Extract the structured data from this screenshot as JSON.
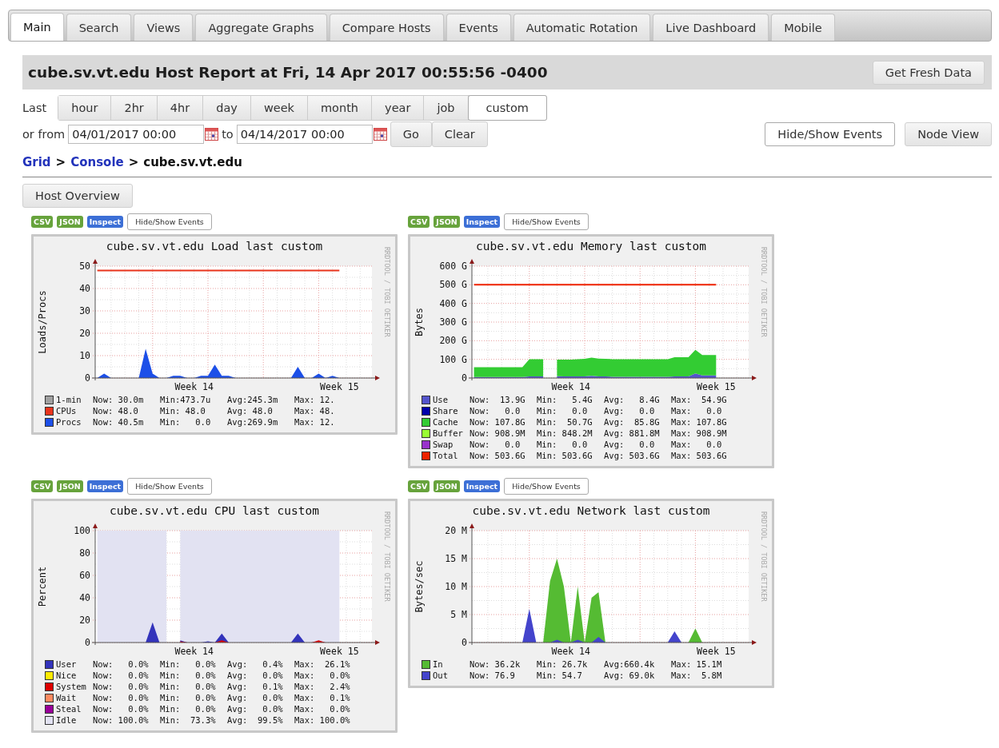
{
  "tabs": [
    {
      "label": "Main",
      "selected": true
    },
    {
      "label": "Search",
      "selected": false
    },
    {
      "label": "Views",
      "selected": false
    },
    {
      "label": "Aggregate Graphs",
      "selected": false
    },
    {
      "label": "Compare Hosts",
      "selected": false
    },
    {
      "label": "Events",
      "selected": false
    },
    {
      "label": "Automatic Rotation",
      "selected": false
    },
    {
      "label": "Live Dashboard",
      "selected": false
    },
    {
      "label": "Mobile",
      "selected": false
    }
  ],
  "report": {
    "title": "cube.sv.vt.edu Host Report at Fri, 14 Apr 2017 00:55:56 -0400",
    "refresh_button": "Get Fresh Data"
  },
  "range": {
    "label": "Last",
    "options": [
      {
        "label": "hour",
        "selected": false
      },
      {
        "label": "2hr",
        "selected": false
      },
      {
        "label": "4hr",
        "selected": false
      },
      {
        "label": "day",
        "selected": false
      },
      {
        "label": "week",
        "selected": false
      },
      {
        "label": "month",
        "selected": false
      },
      {
        "label": "year",
        "selected": false
      },
      {
        "label": "job",
        "selected": false
      },
      {
        "label": "custom",
        "selected": true
      }
    ]
  },
  "custom_range": {
    "label": "or from",
    "from": "04/01/2017 00:00",
    "to_label": "to",
    "to": "04/14/2017 00:00",
    "buttons": [
      "Go",
      "Clear"
    ]
  },
  "right_buttons": [
    {
      "label": "Hide/Show Events",
      "kind": "outline"
    },
    {
      "label": "Node View",
      "kind": "plain"
    }
  ],
  "breadcrumb": [
    {
      "label": "Grid",
      "kind": "link"
    },
    {
      "label": ">",
      "kind": "separator"
    },
    {
      "label": "Console",
      "kind": "link"
    },
    {
      "label": ">",
      "kind": "separator"
    },
    {
      "label": "cube.sv.vt.edu",
      "kind": "current"
    }
  ],
  "overview_button": "Host Overview",
  "graphs": [
    {
      "badges": [
        {
          "label": "CSV",
          "kind": "export"
        },
        {
          "label": "JSON",
          "kind": "export"
        },
        {
          "label": "Inspect",
          "kind": "inspect"
        }
      ],
      "events_button": "Hide/Show Events",
      "side_label": "RRDTOOL / TOBI OETIKER",
      "chart_data": {
        "type": "area",
        "title": "cube.sv.vt.edu Load last custom",
        "ylabel": "Loads/Procs",
        "categories": [
          null,
          null,
          null,
          null,
          null,
          null,
          null,
          null,
          null,
          null,
          null,
          null,
          null,
          null,
          "Week 14",
          null,
          null,
          null,
          null,
          null,
          null,
          null,
          null,
          null,
          null,
          null,
          null,
          null,
          null,
          null,
          null,
          null,
          null,
          null,
          null,
          "Week 15"
        ],
        "ylim": [
          0,
          50
        ],
        "yticks": [
          0,
          10,
          20,
          30,
          40,
          50
        ],
        "grid": true,
        "stacked": false,
        "series": [
          {
            "type": "line",
            "color": "#e8341c",
            "values": [
              48,
              48,
              48,
              48,
              48,
              48,
              48,
              48,
              48,
              48,
              48,
              48,
              48,
              48,
              48,
              48,
              48,
              48,
              48,
              48,
              48,
              48,
              48,
              48,
              48,
              48,
              48,
              48,
              48,
              48,
              48,
              48,
              48,
              48,
              48,
              48
            ]
          },
          {
            "color": "#1c4fe8",
            "values": [
              0,
              2,
              0,
              0,
              0,
              0,
              0,
              13,
              2,
              0,
              0,
              1,
              1,
              0,
              0,
              1,
              1,
              6,
              1,
              1,
              0,
              0,
              0,
              0,
              0,
              0,
              0,
              0,
              0,
              5,
              0,
              0,
              2,
              0,
              1,
              0
            ]
          }
        ]
      },
      "legend": [
        {
          "name": "1-min",
          "color": "#a0a0a0",
          "now": "Now: 30.0m",
          "min": "Min:473.7u",
          "avg": "Avg:245.3m",
          "max": "Max: 12."
        },
        {
          "name": "CPUs",
          "color": "#e8341c",
          "now": "Now: 48.0",
          "min": "Min: 48.0",
          "avg": "Avg: 48.0",
          "max": "Max: 48."
        },
        {
          "name": "Procs",
          "color": "#1c4fe8",
          "now": "Now: 40.5m",
          "min": "Min:   0.0",
          "avg": "Avg:269.9m",
          "max": "Max: 12."
        }
      ]
    },
    {
      "badges": [
        {
          "label": "CSV",
          "kind": "export"
        },
        {
          "label": "JSON",
          "kind": "export"
        },
        {
          "label": "Inspect",
          "kind": "inspect"
        }
      ],
      "events_button": "Hide/Show Events",
      "side_label": "RRDTOOL / TOBI OETIKER",
      "chart_data": {
        "type": "area",
        "title": "cube.sv.vt.edu Memory last custom",
        "ylabel": "Bytes",
        "categories": [
          null,
          null,
          null,
          null,
          null,
          null,
          null,
          null,
          null,
          null,
          null,
          null,
          null,
          null,
          "Week 14",
          null,
          null,
          null,
          null,
          null,
          null,
          null,
          null,
          null,
          null,
          null,
          null,
          null,
          null,
          null,
          null,
          null,
          null,
          null,
          null,
          "Week 15"
        ],
        "ylim": [
          0,
          600
        ],
        "yticks": [
          {
            "value": 0,
            "label": "0"
          },
          {
            "value": 100,
            "label": "100 G"
          },
          {
            "value": 200,
            "label": "200 G"
          },
          {
            "value": 300,
            "label": "300 G"
          },
          {
            "value": 400,
            "label": "400 G"
          },
          {
            "value": 500,
            "label": "500 G"
          },
          {
            "value": 600,
            "label": "600 G"
          }
        ],
        "grid": true,
        "stacked": true,
        "series": [
          {
            "color": "#5555cc",
            "values": [
              5,
              5,
              5,
              5,
              5,
              5,
              5,
              5,
              8,
              8,
              8,
              null,
              10,
              8,
              8,
              8,
              9,
              12,
              8,
              8,
              7,
              7,
              7,
              7,
              7,
              7,
              7,
              7,
              7,
              9,
              9,
              9,
              25,
              14,
              14,
              14
            ]
          },
          {
            "color": "#33cc33",
            "values": [
              53,
              53,
              53,
              53,
              53,
              53,
              53,
              53,
              93,
              93,
              93,
              null,
              89,
              91,
              91,
              93,
              94,
              97,
              96,
              95,
              94,
              94,
              94,
              94,
              94,
              94,
              94,
              94,
              94,
              102,
              103,
              103,
              126,
              109,
              109,
              109
            ]
          },
          {
            "type": "line",
            "color": "#ee2200",
            "values": [
              500,
              500,
              500,
              500,
              500,
              500,
              500,
              500,
              500,
              500,
              500,
              500,
              500,
              500,
              500,
              500,
              500,
              500,
              500,
              500,
              500,
              500,
              500,
              500,
              500,
              500,
              500,
              500,
              500,
              500,
              500,
              500,
              500,
              500,
              500,
              500
            ]
          }
        ]
      },
      "legend": [
        {
          "name": "Use",
          "color": "#5555cc",
          "now": "Now:  13.9G",
          "min": "Min:   5.4G",
          "avg": "Avg:   8.4G",
          "max": "Max:  54.9G"
        },
        {
          "name": "Share",
          "color": "#0000aa",
          "now": "Now:   0.0",
          "min": "Min:   0.0",
          "avg": "Avg:   0.0",
          "max": "Max:   0.0"
        },
        {
          "name": "Cache",
          "color": "#33cc33",
          "now": "Now: 107.8G",
          "min": "Min:  50.7G",
          "avg": "Avg:  85.8G",
          "max": "Max: 107.8G"
        },
        {
          "name": "Buffer",
          "color": "#99ff33",
          "now": "Now: 908.9M",
          "min": "Min: 848.2M",
          "avg": "Avg: 881.8M",
          "max": "Max: 908.9M"
        },
        {
          "name": "Swap",
          "color": "#9933cc",
          "now": "Now:   0.0",
          "min": "Min:   0.0",
          "avg": "Avg:   0.0",
          "max": "Max:   0.0"
        },
        {
          "name": "Total",
          "color": "#ee2200",
          "now": "Now: 503.6G",
          "min": "Min: 503.6G",
          "avg": "Avg: 503.6G",
          "max": "Max: 503.6G"
        }
      ]
    },
    {
      "badges": [
        {
          "label": "CSV",
          "kind": "export"
        },
        {
          "label": "JSON",
          "kind": "export"
        },
        {
          "label": "Inspect",
          "kind": "inspect"
        }
      ],
      "events_button": "Hide/Show Events",
      "side_label": "RRDTOOL / TOBI OETIKER",
      "chart_data": {
        "type": "area",
        "title": "cube.sv.vt.edu CPU last custom",
        "ylabel": "Percent",
        "categories": [
          null,
          null,
          null,
          null,
          null,
          null,
          null,
          null,
          null,
          null,
          null,
          null,
          null,
          null,
          "Week 14",
          null,
          null,
          null,
          null,
          null,
          null,
          null,
          null,
          null,
          null,
          null,
          null,
          null,
          null,
          null,
          null,
          null,
          null,
          null,
          null,
          "Week 15"
        ],
        "ylim": [
          0,
          100
        ],
        "yticks": [
          0,
          20,
          40,
          60,
          80,
          100
        ],
        "grid": true,
        "stacked": false,
        "series": [
          {
            "color": "#e2e2f2",
            "values": [
              100,
              100,
              100,
              100,
              100,
              100,
              100,
              100,
              100,
              100,
              100,
              null,
              100,
              100,
              100,
              100,
              100,
              100,
              100,
              100,
              100,
              100,
              100,
              100,
              100,
              100,
              100,
              100,
              100,
              100,
              100,
              100,
              100,
              100,
              100,
              100
            ]
          },
          {
            "color": "#3333bb",
            "values": [
              0,
              0,
              0,
              0,
              0,
              0,
              0,
              0,
              18,
              0,
              0,
              null,
              2,
              0,
              0,
              0,
              1,
              0,
              8,
              0,
              0,
              0,
              0,
              0,
              0,
              0,
              0,
              0,
              0,
              8,
              0,
              0,
              1,
              0,
              0,
              0
            ]
          },
          {
            "color": "#dd0000",
            "values": [
              null,
              null,
              null,
              null,
              null,
              null,
              null,
              null,
              null,
              null,
              null,
              null,
              1,
              0,
              0,
              0,
              0,
              0,
              2,
              0,
              0,
              0,
              0,
              0,
              0,
              0,
              0,
              0,
              0,
              0,
              0,
              0,
              2,
              0,
              0,
              0
            ]
          }
        ]
      },
      "legend": [
        {
          "name": "User",
          "color": "#3333bb",
          "now": "Now:   0.0%",
          "min": "Min:   0.0%",
          "avg": "Avg:   0.4%",
          "max": "Max:  26.1%"
        },
        {
          "name": "Nice",
          "color": "#ffea00",
          "now": "Now:   0.0%",
          "min": "Min:   0.0%",
          "avg": "Avg:   0.0%",
          "max": "Max:   0.0%"
        },
        {
          "name": "System",
          "color": "#dd0000",
          "now": "Now:   0.0%",
          "min": "Min:   0.0%",
          "avg": "Avg:   0.1%",
          "max": "Max:   2.4%"
        },
        {
          "name": "Wait",
          "color": "#ff8a60",
          "now": "Now:   0.0%",
          "min": "Min:   0.0%",
          "avg": "Avg:   0.0%",
          "max": "Max:   0.1%"
        },
        {
          "name": "Steal",
          "color": "#990099",
          "now": "Now:   0.0%",
          "min": "Min:   0.0%",
          "avg": "Avg:   0.0%",
          "max": "Max:   0.0%"
        },
        {
          "name": "Idle",
          "color": "#e2e2f2",
          "now": "Now: 100.0%",
          "min": "Min:  73.3%",
          "avg": "Avg:  99.5%",
          "max": "Max: 100.0%"
        }
      ]
    },
    {
      "badges": [
        {
          "label": "CSV",
          "kind": "export"
        },
        {
          "label": "JSON",
          "kind": "export"
        },
        {
          "label": "Inspect",
          "kind": "inspect"
        }
      ],
      "events_button": "Hide/Show Events",
      "side_label": "RRDTOOL / TOBI OETIKER",
      "chart_data": {
        "type": "area",
        "title": "cube.sv.vt.edu Network last custom",
        "ylabel": "Bytes/sec",
        "categories": [
          null,
          null,
          null,
          null,
          null,
          null,
          null,
          null,
          null,
          null,
          null,
          null,
          null,
          null,
          "Week 14",
          null,
          null,
          null,
          null,
          null,
          null,
          null,
          null,
          null,
          null,
          null,
          null,
          null,
          null,
          null,
          null,
          null,
          null,
          null,
          null,
          "Week 15"
        ],
        "ylim": [
          0,
          20
        ],
        "yticks": [
          {
            "value": 0,
            "label": "0"
          },
          {
            "value": 5,
            "label": "5 M"
          },
          {
            "value": 10,
            "label": "10 M"
          },
          {
            "value": 15,
            "label": "15 M"
          },
          {
            "value": 20,
            "label": "20 M"
          }
        ],
        "grid": true,
        "stacked": false,
        "series": [
          {
            "color": "#55bb33",
            "values": [
              0,
              0,
              0,
              0,
              0,
              0,
              0,
              0,
              0,
              0,
              0,
              11,
              15,
              10,
              0,
              10,
              0,
              8,
              9,
              0,
              0,
              0,
              0,
              0,
              0,
              0,
              0,
              0,
              0,
              0,
              0,
              0,
              2.5,
              0,
              0,
              0
            ]
          },
          {
            "color": "#4444cc",
            "values": [
              0,
              0,
              0,
              0,
              0,
              0,
              0,
              0,
              6,
              0,
              0,
              0,
              0.5,
              0,
              0,
              0.5,
              0,
              0,
              1,
              0,
              0,
              0,
              0,
              0,
              0,
              0,
              0,
              0,
              0,
              2,
              0,
              0,
              0,
              0,
              0,
              0
            ]
          }
        ]
      },
      "legend": [
        {
          "name": "In",
          "color": "#55bb33",
          "now": "Now: 36.2k",
          "min": "Min: 26.7k",
          "avg": "Avg:660.4k",
          "max": "Max: 15.1M"
        },
        {
          "name": "Out",
          "color": "#4444cc",
          "now": "Now: 76.9",
          "min": "Min: 54.7",
          "avg": "Avg: 69.0k",
          "max": "Max:  5.8M"
        }
      ]
    }
  ]
}
